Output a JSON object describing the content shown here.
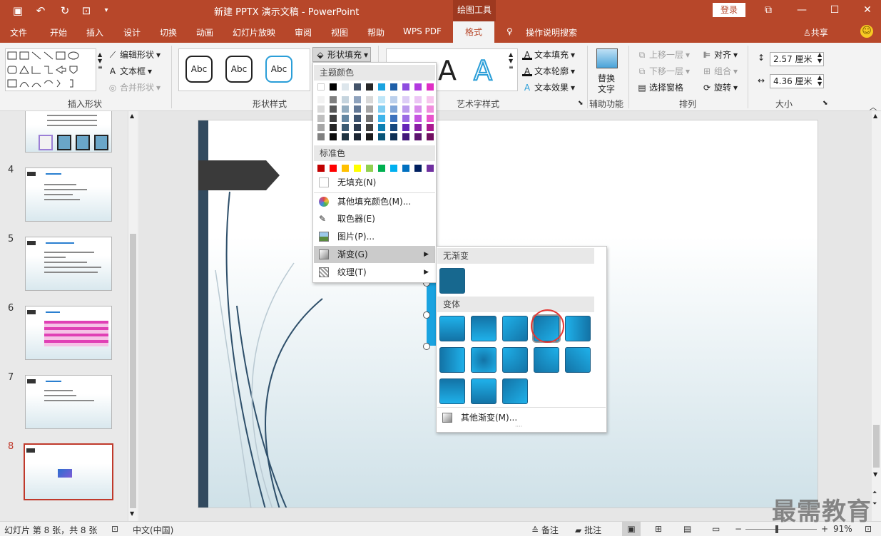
{
  "titlebar": {
    "title": "新建 PPTX 演示文稿  -  PowerPoint",
    "context_tools": "绘图工具",
    "login": "登录"
  },
  "tabs": [
    "文件",
    "开始",
    "插入",
    "设计",
    "切换",
    "动画",
    "幻灯片放映",
    "审阅",
    "视图",
    "帮助",
    "WPS PDF",
    "格式",
    "操作说明搜索"
  ],
  "active_tab": "格式",
  "share": "共享",
  "ribbon": {
    "insert_shapes": {
      "label": "插入形状",
      "edit_shape": "编辑形状",
      "text_box": "文本框",
      "merge_shapes": "合并形状"
    },
    "shape_styles": {
      "label": "形状样式",
      "sample": "Abc",
      "shape_fill": "形状填充"
    },
    "wordart": {
      "label": "艺术字样式",
      "text_fill": "文本填充",
      "text_outline": "文本轮廓",
      "text_effects": "文本效果",
      "sample": "A"
    },
    "accessibility": {
      "label": "辅助功能",
      "alt_text_1": "替换",
      "alt_text_2": "文字"
    },
    "arrange": {
      "label": "排列",
      "bring_forward": "上移一层",
      "send_backward": "下移一层",
      "selection_pane": "选择窗格",
      "align": "对齐",
      "group": "组合",
      "rotate": "旋转"
    },
    "size": {
      "label": "大小",
      "height": "2.57 厘米",
      "width": "4.36 厘米"
    }
  },
  "slides": [
    {
      "num": "4"
    },
    {
      "num": "5"
    },
    {
      "num": "6"
    },
    {
      "num": "7"
    },
    {
      "num": "8"
    }
  ],
  "fill_menu": {
    "theme_colors": "主题颜色",
    "standard_colors": "标准色",
    "no_fill": "无填充(N)",
    "more_colors": "其他填充颜色(M)...",
    "eyedropper": "取色器(E)",
    "picture": "图片(P)...",
    "gradient": "渐变(G)",
    "texture": "纹理(T)",
    "theme_top": [
      "#ffffff",
      "#000000",
      "#dde6ec",
      "#44546a",
      "#262626",
      "#1aa3e0",
      "#1f5fa8",
      "#8e4de0",
      "#b23ae0",
      "#e02ec4"
    ],
    "theme_shade_cols": [
      [
        "#f2f2f2",
        "#d9d9d9",
        "#bfbfbf",
        "#a6a6a6",
        "#808080"
      ],
      [
        "#808080",
        "#595959",
        "#404040",
        "#262626",
        "#0d0d0d"
      ],
      [
        "#c5d4de",
        "#93adc0",
        "#6487a2",
        "#3c5b73",
        "#1f3341"
      ],
      [
        "#8ea2bd",
        "#627896",
        "#3e5470",
        "#2c3b4f",
        "#1c2633"
      ],
      [
        "#d9d9d9",
        "#a6a6a6",
        "#737373",
        "#404040",
        "#1a1a1a"
      ],
      [
        "#bfe6f8",
        "#80cdf1",
        "#3fb4ea",
        "#0e7fb2",
        "#095477"
      ],
      [
        "#bcd0ec",
        "#7fa5d8",
        "#3d72bd",
        "#17477e",
        "#0f2f54"
      ],
      [
        "#ddcdf6",
        "#bb9bed",
        "#9a6ae4",
        "#6424b8",
        "#42187a"
      ],
      [
        "#ecc6f5",
        "#d98dec",
        "#c655e2",
        "#8a1fa6",
        "#5c146e"
      ],
      [
        "#f8c6ee",
        "#f08ddd",
        "#e955cc",
        "#ab1a90",
        "#720f60"
      ]
    ],
    "standard": [
      "#c00000",
      "#ff0000",
      "#ffc000",
      "#ffff00",
      "#92d050",
      "#00b050",
      "#00b0f0",
      "#0070c0",
      "#002060",
      "#7030a0"
    ]
  },
  "gradient_menu": {
    "no_gradient": "无渐变",
    "variants": "变体",
    "more": "其他渐变(M)..."
  },
  "status": {
    "slide_info": "幻灯片 第 8 张，共 8 张",
    "language": "中文(中国)",
    "notes": "备注",
    "comments": "批注",
    "zoom": "91%"
  },
  "watermark": "最需教育"
}
